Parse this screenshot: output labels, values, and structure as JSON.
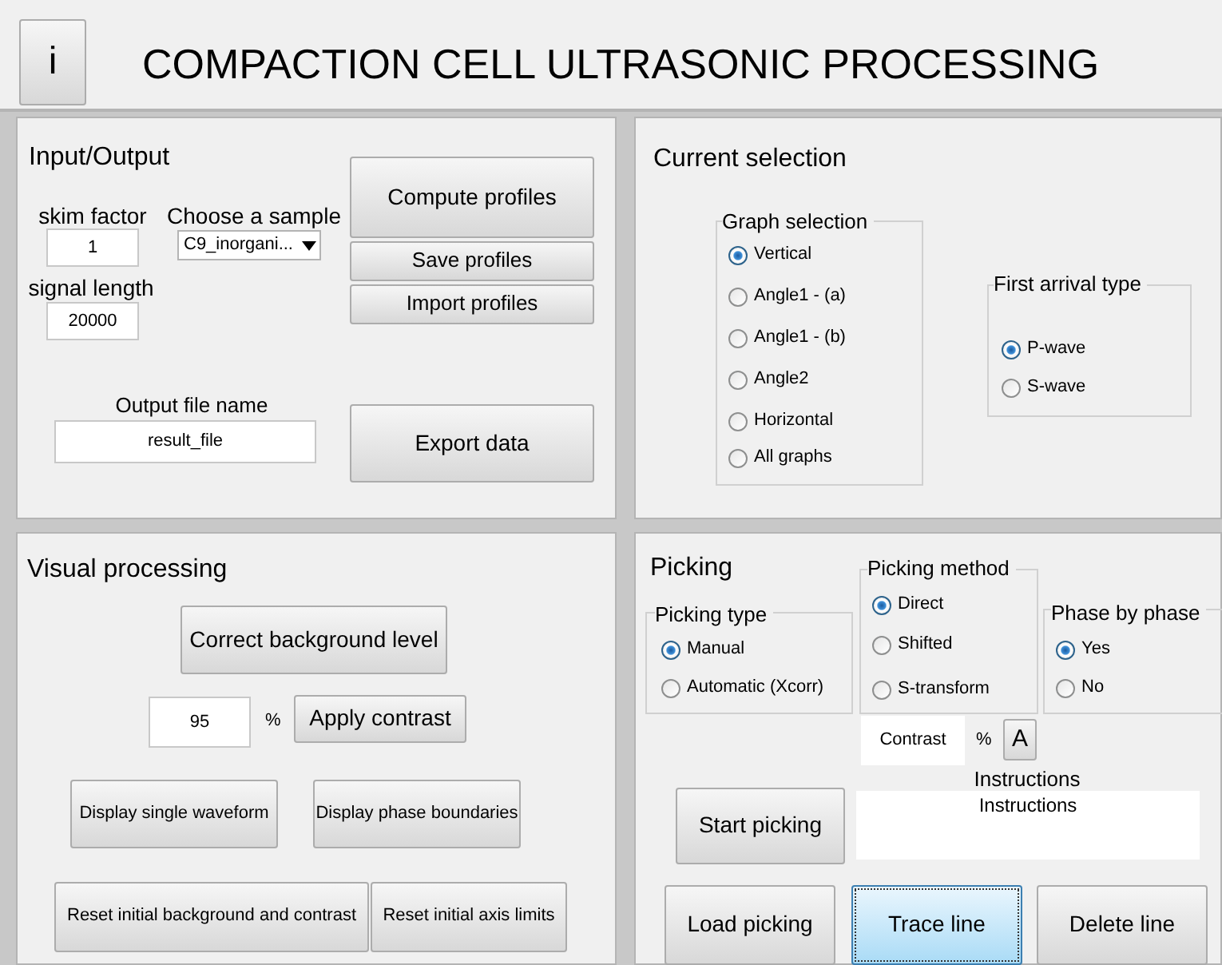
{
  "header": {
    "info_button": "i",
    "title": "COMPACTION CELL ULTRASONIC PROCESSING"
  },
  "input_output": {
    "title": "Input/Output",
    "skim_factor": {
      "label": "skim factor",
      "value": "1"
    },
    "sample": {
      "label": "Choose a sample",
      "value": "C9_inorgani..."
    },
    "signal_length": {
      "label": "signal length",
      "value": "20000"
    },
    "buttons": [
      "Compute profiles",
      "Save profiles",
      "Import profiles"
    ],
    "output_file": {
      "label": "Output file name",
      "value": "result_file"
    },
    "export_button": "Export data"
  },
  "current_selection": {
    "title": "Current selection",
    "groups": [
      {
        "title": "Graph selection",
        "options": [
          {
            "label": "Vertical",
            "selected": true
          },
          {
            "label": "Angle1 - (a)",
            "selected": false
          },
          {
            "label": "Angle1 - (b)",
            "selected": false
          },
          {
            "label": "Angle2",
            "selected": false
          },
          {
            "label": "Horizontal",
            "selected": false
          },
          {
            "label": "All graphs",
            "selected": false
          }
        ]
      },
      {
        "title": "First arrival type",
        "options": [
          {
            "label": "P-wave",
            "selected": true
          },
          {
            "label": "S-wave",
            "selected": false
          }
        ]
      }
    ]
  },
  "visual_processing": {
    "title": "Visual processing",
    "correct_button": "Correct background level",
    "contrast": {
      "value": "95",
      "unit": "%",
      "button": "Apply contrast"
    },
    "buttons": [
      "Display single waveform",
      "Display phase boundaries",
      "Reset initial background and contrast",
      "Reset initial axis limits"
    ]
  },
  "picking": {
    "title": "Picking",
    "groups": [
      {
        "title": "Picking type",
        "options": [
          {
            "label": "Manual",
            "selected": true
          },
          {
            "label": "Automatic (Xcorr)",
            "selected": false
          }
        ]
      },
      {
        "title": "Picking method",
        "options": [
          {
            "label": "Direct",
            "selected": true
          },
          {
            "label": "Shifted",
            "selected": false
          },
          {
            "label": "S-transform",
            "selected": false
          }
        ]
      },
      {
        "title": "Phase by phase",
        "options": [
          {
            "label": "Yes",
            "selected": true
          },
          {
            "label": "No",
            "selected": false
          }
        ]
      }
    ],
    "contrast": {
      "value": "Contrast",
      "unit": "%",
      "button": "A"
    },
    "instructions": {
      "label": "Instructions",
      "text": "Instructions"
    },
    "start_button": "Start picking",
    "buttons": [
      {
        "label": "Load picking",
        "focused": false
      },
      {
        "label": "Trace line",
        "focused": true
      },
      {
        "label": "Delete line",
        "focused": false
      }
    ]
  }
}
